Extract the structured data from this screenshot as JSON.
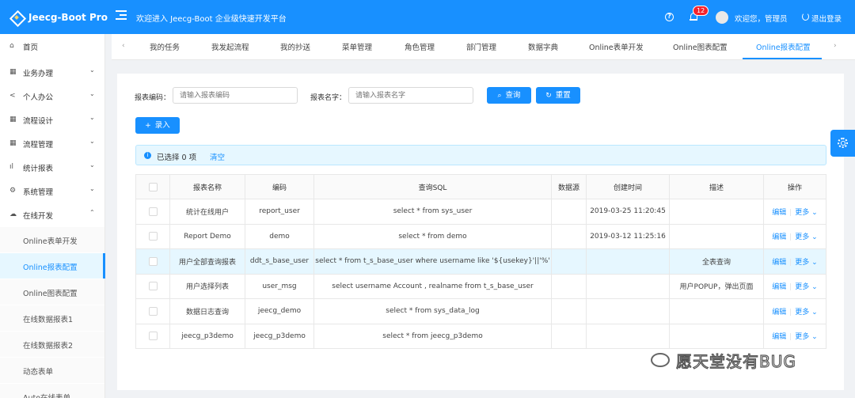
{
  "header": {
    "logo": "Jeecg-Boot Pro",
    "welcome": "欢迎进入 Jeecg-Boot 企业级快速开发平台",
    "notify_count": "12",
    "user_greeting": "欢迎您，管理员",
    "logout": "退出登录",
    "brand_color": "#1890ff"
  },
  "sidebar": {
    "items": [
      {
        "label": "首页",
        "icon": "home-icon"
      },
      {
        "label": "业务办理",
        "icon": "grid-icon"
      },
      {
        "label": "个人办公",
        "icon": "share-icon"
      },
      {
        "label": "流程设计",
        "icon": "grid-icon"
      },
      {
        "label": "流程管理",
        "icon": "grid-icon"
      },
      {
        "label": "统计报表",
        "icon": "bar-chart-icon"
      },
      {
        "label": "系统管理",
        "icon": "gear-icon"
      },
      {
        "label": "在线开发",
        "icon": "cloud-icon"
      }
    ],
    "sub_items": [
      {
        "label": "Online表单开发"
      },
      {
        "label": "Online报表配置"
      },
      {
        "label": "Online图表配置"
      },
      {
        "label": "在线数据报表1"
      },
      {
        "label": "在线数据报表2"
      },
      {
        "label": "动态表单"
      },
      {
        "label": "Auto在线表单"
      }
    ]
  },
  "tabs": [
    {
      "label": "我的任务"
    },
    {
      "label": "我发起流程"
    },
    {
      "label": "我的抄送"
    },
    {
      "label": "菜单管理"
    },
    {
      "label": "角色管理"
    },
    {
      "label": "部门管理"
    },
    {
      "label": "数据字典"
    },
    {
      "label": "Online表单开发"
    },
    {
      "label": "Online图表配置"
    },
    {
      "label": "Online报表配置"
    }
  ],
  "search": {
    "code_label": "报表编码：",
    "code_placeholder": "请输入报表编码",
    "name_label": "报表名字：",
    "name_placeholder": "请输入报表名字",
    "query_button": "查询",
    "reset_button": "重置",
    "add_button": "录入"
  },
  "selection": {
    "text": "已选择 0 项",
    "clear": "清空"
  },
  "table": {
    "headers": [
      "报表名称",
      "编码",
      "查询SQL",
      "数据源",
      "创建时间",
      "描述",
      "操作"
    ],
    "edit_label": "编辑",
    "more_label": "更多",
    "rows": [
      {
        "name": "统计在线用户",
        "code": "report_user",
        "sql": "select * from sys_user",
        "datasource": "",
        "created": "2019-03-25 11:20:45",
        "desc": ""
      },
      {
        "name": "Report Demo",
        "code": "demo",
        "sql": "select * from demo",
        "datasource": "",
        "created": "2019-03-12 11:25:16",
        "desc": ""
      },
      {
        "name": "用户全部查询报表",
        "code": "ddt_s_base_user",
        "sql": "select * from t_s_base_user where username like '${usekey}'||'%'",
        "datasource": "",
        "created": "",
        "desc": "全表查询"
      },
      {
        "name": "用户选择列表",
        "code": "user_msg",
        "sql": "select username Account , realname from t_s_base_user",
        "datasource": "",
        "created": "",
        "desc": "用户POPUP，弹出页面"
      },
      {
        "name": "数据日志查询",
        "code": "jeecg_demo",
        "sql": "select * from sys_data_log",
        "datasource": "",
        "created": "",
        "desc": ""
      },
      {
        "name": "jeecg_p3demo",
        "code": "jeecg_p3demo",
        "sql": "select * from jeecg_p3demo",
        "datasource": "",
        "created": "",
        "desc": ""
      }
    ]
  },
  "watermark": "愿天堂没有BUG"
}
